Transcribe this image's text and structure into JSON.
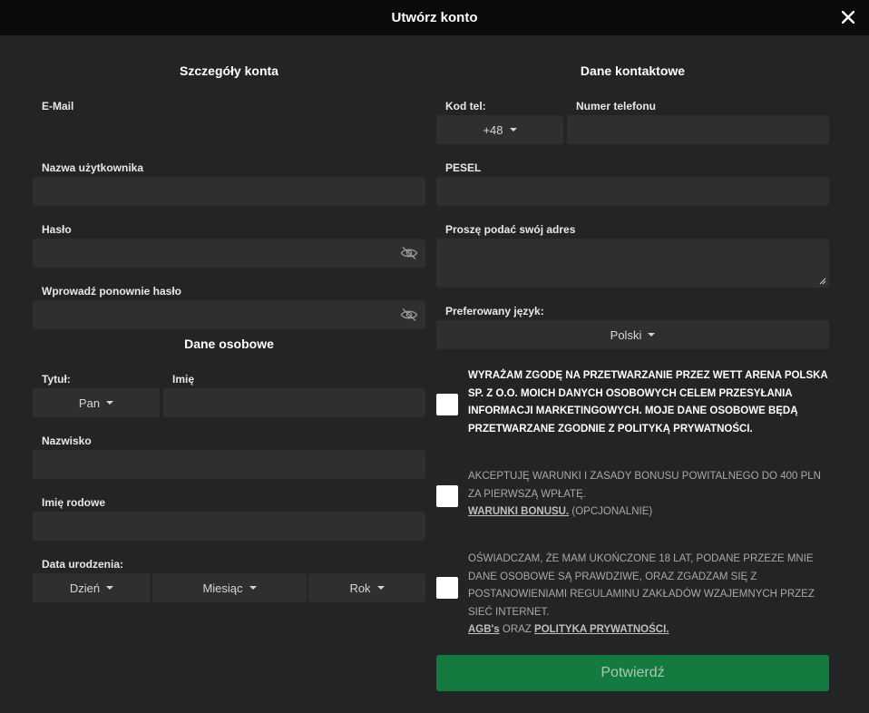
{
  "header": {
    "title": "Utwórz konto"
  },
  "account": {
    "title": "Szczegóły konta",
    "email_label": "E-Mail",
    "username_label": "Nazwa użytkownika",
    "password_label": "Hasło",
    "password_repeat_label": "Wprowadź ponownie hasło"
  },
  "personal": {
    "title": "Dane osobowe",
    "title_label": "Tytuł:",
    "title_value": "Pan",
    "first_name_label": "Imię",
    "last_name_label": "Nazwisko",
    "family_name_label": "Imię rodowe",
    "birthdate_label": "Data urodzenia:",
    "day_value": "Dzień",
    "month_value": "Miesiąc",
    "year_value": "Rok"
  },
  "contact": {
    "title": "Dane kontaktowe",
    "phone_code_label": "Kod tel:",
    "phone_code_value": "+48",
    "phone_number_label": "Numer telefonu",
    "pesel_label": "PESEL",
    "address_label": "Proszę podać swój adres",
    "language_label": "Preferowany język:",
    "language_value": "Polski"
  },
  "consents": {
    "marketing": "Wyrażam zgodę na przetwarzanie przez WETT ARENA POLSKA SP. Z O.O. moich danych osobowych celem przesyłania informacji marketingowych. Moje dane osobowe będą przetwarzane zgodnie z polityką prywatności.",
    "bonus_text": "Akceptuję warunki i zasady bonusu powitalnego do 400 PLN za pierwszą wpłatę.",
    "bonus_link": "Warunki bonusu.",
    "bonus_optional": "(Opcjonalnie)",
    "age_text": "Oświadczam, że mam ukończone 18 lat, podane przeze mnie dane osobowe są prawdziwe, oraz zgadzam się z postanowieniami regulaminu zakładów wzajemnych przez sieć internet.",
    "agb_link": "AGB's",
    "and_word": "oraz",
    "privacy_link": "Polityka prywatności."
  },
  "submit_label": "Potwierdź",
  "colors": {
    "background": "#232425",
    "header": "#0b0b0b",
    "field": "#2d2f30",
    "accent": "#147a3f"
  }
}
